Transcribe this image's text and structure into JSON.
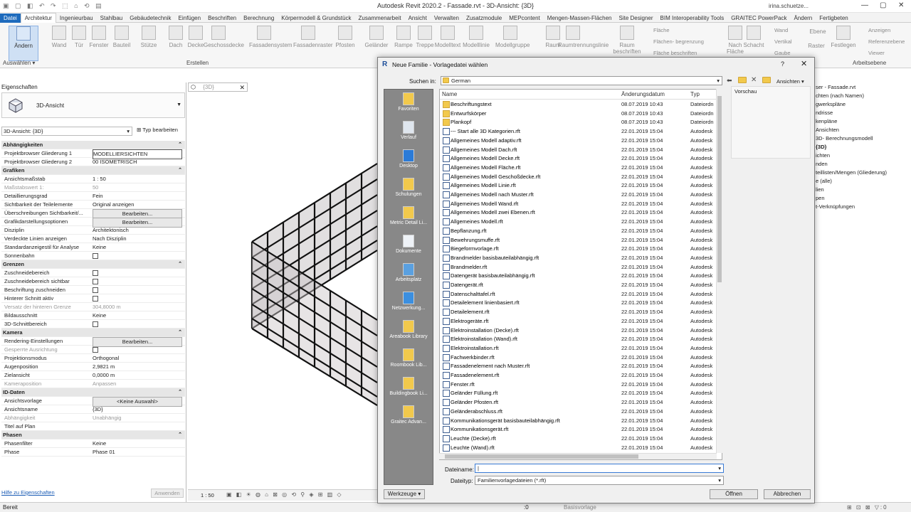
{
  "window": {
    "title": "Autodesk Revit 2020.2 - Fassade.rvt - 3D-Ansicht: {3D}",
    "user": "irina.schuetze..."
  },
  "ribbon": {
    "tabs": [
      "Datei",
      "Architektur",
      "Ingenieurbau",
      "Stahlbau",
      "Gebäudetechnik",
      "Einfügen",
      "Beschriften",
      "Berechnung",
      "Körpermodell & Grundstück",
      "Zusammenarbeit",
      "Ansicht",
      "Verwalten",
      "Zusatzmodule",
      "MEPcontent",
      "Mengen-Massen-Flächen",
      "Site Designer",
      "BIM Interoperability Tools",
      "GRAITEC PowerPack",
      "Ändern",
      "Fertigbeten"
    ],
    "buttons": [
      "Ändern",
      "Wand",
      "Tür",
      "Fenster",
      "Bauteil",
      "Stütze",
      "Dach",
      "Decke",
      "Geschossdecke",
      "Fassadensystem",
      "Fassadenraster",
      "Pfosten",
      "Geländer",
      "Rampe",
      "Treppe",
      "Modelltext",
      "Modelllinie",
      "Modellgruppe",
      "Raum",
      "Raumtrennungslinie",
      "Raum beschriften",
      "Nach Fläche",
      "Schacht",
      "Ebene",
      "Raster",
      "Festlegen"
    ],
    "small": [
      "Fläche",
      "Flächen- begrenzung",
      "Fläche beschriften",
      "Wand",
      "Vertikal",
      "Gaube",
      "Anzeigen",
      "Referenzebene",
      "Viewer"
    ],
    "panels": {
      "select": "Auswählen",
      "build": "Erstellen",
      "workplane": "Arbeitsebene"
    }
  },
  "properties": {
    "header": "Eigenschaften",
    "type_name": "3D-Ansicht",
    "instance_select": "3D-Ansicht: {3D}",
    "edit_type": "Typ bearbeiten",
    "rows": [
      {
        "k": "Abhängigkeiten",
        "group": true
      },
      {
        "k": "Projektbrowser Gliederung 1",
        "v": "MODELLIERSICHTEN",
        "box": true
      },
      {
        "k": "Projektbrowser Gliederung 2",
        "v": "00 ISOMETRISCH"
      },
      {
        "k": "Grafiken",
        "group": true
      },
      {
        "k": "Ansichtsmaßstab",
        "v": "1 : 50"
      },
      {
        "k": "Maßstabswert 1:",
        "v": "50",
        "gray": true
      },
      {
        "k": "Detaillierungsgrad",
        "v": "Fein"
      },
      {
        "k": "Sichtbarkeit der Teilelemente",
        "v": "Original anzeigen"
      },
      {
        "k": "Überschreibungen Sichtbarkeit/...",
        "v": "Bearbeiten...",
        "btn": true
      },
      {
        "k": "Grafikdarstellungsoptionen",
        "v": "Bearbeiten...",
        "btn": true
      },
      {
        "k": "Disziplin",
        "v": "Architektonisch"
      },
      {
        "k": "Verdeckte Linien anzeigen",
        "v": "Nach Disziplin"
      },
      {
        "k": "Standardanzeigestil für Analyse",
        "v": "Keine"
      },
      {
        "k": "Sonnenbahn",
        "chk": true
      },
      {
        "k": "Grenzen",
        "group": true
      },
      {
        "k": "Zuschneidebereich",
        "chk": true
      },
      {
        "k": "Zuschneidebereich sichtbar",
        "chk": true
      },
      {
        "k": "Beschriftung zuschneiden",
        "chk": true
      },
      {
        "k": "Hinterer Schnitt aktiv",
        "chk": true
      },
      {
        "k": "Versatz der hinteren Grenze",
        "v": "304,8000 m",
        "gray": true
      },
      {
        "k": "Bildausschnitt",
        "v": "Keine"
      },
      {
        "k": "3D-Schnittbereich",
        "chk": true
      },
      {
        "k": "Kamera",
        "group": true
      },
      {
        "k": "Rendering-Einstellungen",
        "v": "Bearbeiten...",
        "btn": true
      },
      {
        "k": "Gesperrte Ausrichtung",
        "chk": true,
        "gray": true
      },
      {
        "k": "Projektionsmodus",
        "v": "Orthogonal"
      },
      {
        "k": "Augenposition",
        "v": "2,9821 m"
      },
      {
        "k": "Zielansicht",
        "v": "0,0000 m"
      },
      {
        "k": "Kameraposition",
        "v": "Anpassen",
        "gray": true
      },
      {
        "k": "ID-Daten",
        "group": true
      },
      {
        "k": "Ansichtsvorlage",
        "v": "<Keine Auswahl>",
        "btn": true
      },
      {
        "k": "Ansichtsname",
        "v": "{3D}"
      },
      {
        "k": "Abhängigkeit",
        "v": "Unabhängig",
        "gray": true
      },
      {
        "k": "Titel auf Plan",
        "v": ""
      },
      {
        "k": "Phasen",
        "group": true
      },
      {
        "k": "Phasenfilter",
        "v": "Keine"
      },
      {
        "k": "Phase",
        "v": "Phase 01"
      }
    ],
    "help_link": "Hilfe zu Eigenschaften",
    "apply": "Anwenden"
  },
  "view": {
    "tab": "{3D}",
    "scale": "1 : 50"
  },
  "browser_items": [
    "ser - Fassade.rvt",
    "chten (nach Namen)",
    "gwerkspläne",
    "ndrisse",
    "kenpläne",
    "Ansichten",
    "3D- Berechnungsmodell",
    "{3D}",
    "ichten",
    "nden",
    "teillisten/Mengen (Gliederung)",
    "e (alle)",
    "lien",
    "pen",
    "t-Verknüpfungen"
  ],
  "status": {
    "text": "Bereit",
    "workset": "Basisvorlage",
    "zero": ":0"
  },
  "dialog": {
    "title": "Neue Familie - Vorlagedatei wählen",
    "help": "?",
    "look_in_label": "Suchen in:",
    "look_in_value": "German",
    "views_label": "Ansichten",
    "preview_label": "Vorschau",
    "columns": {
      "name": "Name",
      "date": "Änderungsdatum",
      "type": "Typ"
    },
    "places": [
      "Favoriten",
      "Verlauf",
      "Desktop",
      "Schulungen",
      "Metric Detail Li...",
      "Dokumente",
      "Arbeitsplatz",
      "Netzwerkung...",
      "Areabook Library",
      "Roombook Lib...",
      "Buildingbook Li...",
      "Graitec Advan..."
    ],
    "files": [
      {
        "n": "Beschriftungstext",
        "d": "08.07.2019 10:43",
        "t": "Dateiordn",
        "f": true
      },
      {
        "n": "Entwurfskörper",
        "d": "08.07.2019 10:43",
        "t": "Dateiordn",
        "f": true
      },
      {
        "n": "Plankopf",
        "d": "08.07.2019 10:43",
        "t": "Dateiordn",
        "f": true
      },
      {
        "n": "--- Start alle 3D Kategorien.rft",
        "d": "22.01.2019 15:04",
        "t": "Autodesk"
      },
      {
        "n": "Allgemeines Modell adaptiv.rft",
        "d": "22.01.2019 15:04",
        "t": "Autodesk"
      },
      {
        "n": "Allgemeines Modell Dach.rft",
        "d": "22.01.2019 15:04",
        "t": "Autodesk"
      },
      {
        "n": "Allgemeines Modell Decke.rft",
        "d": "22.01.2019 15:04",
        "t": "Autodesk"
      },
      {
        "n": "Allgemeines Modell Fläche.rft",
        "d": "22.01.2019 15:04",
        "t": "Autodesk"
      },
      {
        "n": "Allgemeines Modell Geschoßdecke.rft",
        "d": "22.01.2019 15:04",
        "t": "Autodesk"
      },
      {
        "n": "Allgemeines Modell Linie.rft",
        "d": "22.01.2019 15:04",
        "t": "Autodesk"
      },
      {
        "n": "Allgemeines Modell nach Muster.rft",
        "d": "22.01.2019 15:04",
        "t": "Autodesk"
      },
      {
        "n": "Allgemeines Modell Wand.rft",
        "d": "22.01.2019 15:04",
        "t": "Autodesk"
      },
      {
        "n": "Allgemeines Modell zwei Ebenen.rft",
        "d": "22.01.2019 15:04",
        "t": "Autodesk"
      },
      {
        "n": "Allgemeines Modell.rft",
        "d": "22.01.2019 15:04",
        "t": "Autodesk"
      },
      {
        "n": "Bepflanzung.rft",
        "d": "22.01.2019 15:04",
        "t": "Autodesk"
      },
      {
        "n": "Bewehrungsmuffe.rft",
        "d": "22.01.2019 15:04",
        "t": "Autodesk"
      },
      {
        "n": "Biegeformvorlage.rft",
        "d": "22.01.2019 15:04",
        "t": "Autodesk"
      },
      {
        "n": "Brandmelder basisbauteilabhängig.rft",
        "d": "22.01.2019 15:04",
        "t": "Autodesk"
      },
      {
        "n": "Brandmelder.rft",
        "d": "22.01.2019 15:04",
        "t": "Autodesk"
      },
      {
        "n": "Datengerät basisbauteilabhängig.rft",
        "d": "22.01.2019 15:04",
        "t": "Autodesk"
      },
      {
        "n": "Datengerät.rft",
        "d": "22.01.2019 15:04",
        "t": "Autodesk"
      },
      {
        "n": "Datenschalttafel.rft",
        "d": "22.01.2019 15:04",
        "t": "Autodesk"
      },
      {
        "n": "Detailelement linienbasiert.rft",
        "d": "22.01.2019 15:04",
        "t": "Autodesk"
      },
      {
        "n": "Detailelement.rft",
        "d": "22.01.2019 15:04",
        "t": "Autodesk"
      },
      {
        "n": "Elektrogeräte.rft",
        "d": "22.01.2019 15:04",
        "t": "Autodesk"
      },
      {
        "n": "Elektroinstallation (Decke).rft",
        "d": "22.01.2019 15:04",
        "t": "Autodesk"
      },
      {
        "n": "Elektroinstallation (Wand).rft",
        "d": "22.01.2019 15:04",
        "t": "Autodesk"
      },
      {
        "n": "Elektroinstallation.rft",
        "d": "22.01.2019 15:04",
        "t": "Autodesk"
      },
      {
        "n": "Fachwerkbinder.rft",
        "d": "22.01.2019 15:04",
        "t": "Autodesk"
      },
      {
        "n": "Fassadenelement nach Muster.rft",
        "d": "22.01.2019 15:04",
        "t": "Autodesk"
      },
      {
        "n": "Fassadenelement.rft",
        "d": "22.01.2019 15:04",
        "t": "Autodesk"
      },
      {
        "n": "Fenster.rft",
        "d": "22.01.2019 15:04",
        "t": "Autodesk"
      },
      {
        "n": "Geländer Füllung.rft",
        "d": "22.01.2019 15:04",
        "t": "Autodesk"
      },
      {
        "n": "Geländer Pfosten.rft",
        "d": "22.01.2019 15:04",
        "t": "Autodesk"
      },
      {
        "n": "Geländerabschluss.rft",
        "d": "22.01.2019 15:04",
        "t": "Autodesk"
      },
      {
        "n": "Kommunikationsgerät basisbauteilabhängig.rft",
        "d": "22.01.2019 15:04",
        "t": "Autodesk"
      },
      {
        "n": "Kommunikationsgerät.rft",
        "d": "22.01.2019 15:04",
        "t": "Autodesk"
      },
      {
        "n": "Leuchte (Decke).rft",
        "d": "22.01.2019 15:04",
        "t": "Autodesk"
      },
      {
        "n": "Leuchte (Wand).rft",
        "d": "22.01.2019 15:04",
        "t": "Autodesk"
      }
    ],
    "filename_label": "Dateiname:",
    "filename_value": "",
    "filetype_label": "Dateityp:",
    "filetype_value": "Familienvorlagedateien  (*.rft)",
    "tools": "Werkzeuge",
    "open": "Öffnen",
    "cancel": "Abbrechen"
  }
}
